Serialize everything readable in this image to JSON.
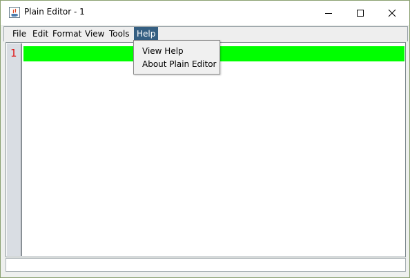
{
  "window": {
    "title": "Plain Editor - 1",
    "controls": [
      "minimize",
      "maximize",
      "close"
    ]
  },
  "menubar": {
    "items": [
      "File",
      "Edit",
      "Format",
      "View",
      "Tools",
      "Help"
    ],
    "active": "Help"
  },
  "help_menu": {
    "items": [
      "View Help",
      "About Plain Editor"
    ]
  },
  "editor": {
    "line_numbers": [
      "1"
    ],
    "current_line_color": "#00ff00",
    "line_number_color": "#e01010"
  },
  "colors": {
    "menu_active_bg": "#355f82",
    "gutter_bg": "#d9dde3"
  }
}
